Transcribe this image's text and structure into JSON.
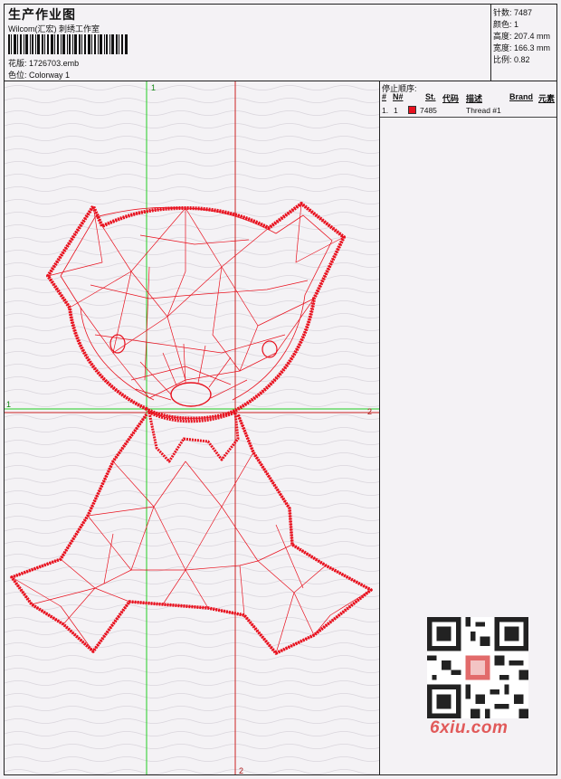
{
  "header": {
    "title": "生产作业图",
    "studio": "Wilcom(汇宏) 刺绣工作室",
    "design_label": "花版:",
    "design_value": "1726703.emb",
    "colorway_label": "色位:",
    "colorway_value": "Colorway 1"
  },
  "specs": {
    "stitches_label": "针数:",
    "stitches_value": "7487",
    "colors_label": "颜色:",
    "colors_value": "1",
    "height_label": "高度:",
    "height_value": "207.4 mm",
    "width_label": "宽度:",
    "width_value": "166.3 mm",
    "scale_label": "比例:",
    "scale_value": "0.82"
  },
  "stop_sequence": {
    "title": "停止顺序:",
    "columns": [
      "#",
      "N#",
      "St.",
      "代码",
      "描述",
      "Brand",
      "元素"
    ],
    "rows": [
      {
        "index": "1.",
        "needle": "1",
        "code": "7485",
        "description": "Thread #1",
        "color": "#e8111e"
      }
    ]
  },
  "guides": {
    "v1_label": "1",
    "v2_label": "2",
    "h1_label": "1",
    "h2_label": "2"
  },
  "watermark": {
    "text": "6xiu.com"
  },
  "colors": {
    "thread": "#e8111e",
    "guide_green": "#22cc22",
    "guide_red": "#cc2222"
  }
}
